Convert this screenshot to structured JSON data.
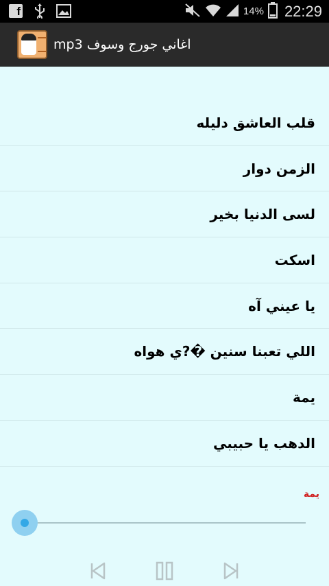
{
  "status_bar": {
    "icons": [
      "facebook-icon",
      "usb-icon",
      "image-icon",
      "no-sound-icon",
      "wifi-icon",
      "signal-icon",
      "battery-icon"
    ],
    "battery": "14%",
    "time": "22:29"
  },
  "app_bar": {
    "title": "اغاني جورج وسوف mp3"
  },
  "songs": [
    {
      "title": "قلب العاشق دليله"
    },
    {
      "title": "الزمن دوار"
    },
    {
      "title": "لسى الدنيا بخير"
    },
    {
      "title": "اسكت"
    },
    {
      "title": "يا عيني آه"
    },
    {
      "title": "اللي تعبنا سنين �?ي هواه"
    },
    {
      "title": "يمة"
    },
    {
      "title": "الدهب يا حبيبي"
    }
  ],
  "player": {
    "now_playing": "يمة",
    "progress": 0,
    "controls": [
      "previous-icon",
      "pause-icon",
      "next-icon"
    ]
  }
}
